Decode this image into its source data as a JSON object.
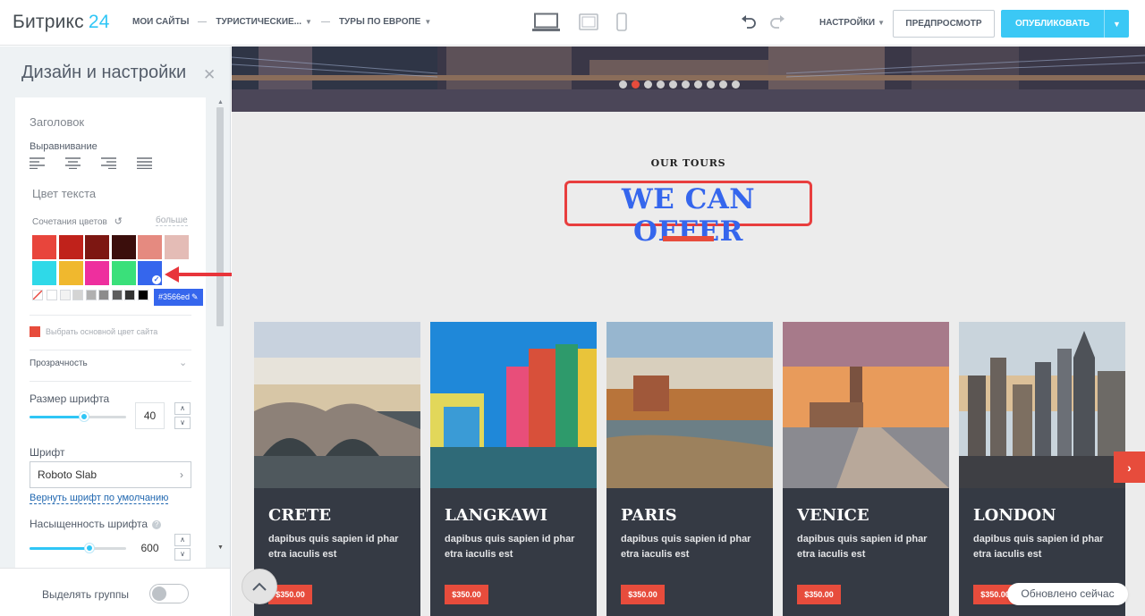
{
  "app": {
    "logo_name": "Битрикс",
    "logo_num": "24"
  },
  "breadcrumbs": [
    "МОИ САЙТЫ",
    "ТУРИСТИЧЕСКИЕ...",
    "ТУРЫ ПО ЕВРОПЕ"
  ],
  "toolbar": {
    "devices": [
      "desktop-icon",
      "tablet-icon",
      "mobile-icon"
    ],
    "active_device": "desktop-icon",
    "settings_label": "НАСТРОЙКИ",
    "preview_label": "ПРЕДПРОСМОТР",
    "publish_label": "ОПУБЛИКОВАТЬ"
  },
  "panel": {
    "title": "Дизайн и настройки",
    "section_title": "Заголовок",
    "alignment_label": "Выравнивание",
    "text_color_label": "Цвет текста",
    "color_combos_label": "Сочетания цветов",
    "more_label": "больше",
    "palette_row1": [
      "#e8453c",
      "#c0221b",
      "#7d1712",
      "#3b0e0c",
      "#e58a80",
      "#e4bcb6"
    ],
    "palette_row2": [
      "#2fd9e8",
      "#f0b82e",
      "#ee2f9e",
      "#3ae07a",
      "#3566ed"
    ],
    "selected_color": "#3566ed",
    "grays": [
      "#ffffff",
      "#f2f2f2",
      "#d4d4d4",
      "#b0b0b0",
      "#8c8c8c",
      "#5e5e5e",
      "#333333",
      "#000000"
    ],
    "hex_value": "#3566ed",
    "site_color_label": "Выбрать основной цвет сайта",
    "opacity_label": "Прозрачность",
    "font_size_label": "Размер шрифта",
    "font_size_value": "40",
    "font_size_fraction": 0.57,
    "font_label": "Шрифт",
    "font_value": "Roboto Slab",
    "reset_font_link": "Вернуть шрифт по умолчанию",
    "font_weight_label": "Насыщенность шрифта",
    "font_weight_value": "600",
    "font_weight_fraction": 0.63,
    "group_toggle_label": "Выделять группы",
    "group_toggle_on": false
  },
  "preview": {
    "slider_dot_count": 10,
    "slider_active_index": 1,
    "subtitle": "OUR TOURS",
    "heading": "WE CAN OFFER",
    "heading_color": "#3566ed",
    "tours": [
      {
        "name": "CRETE",
        "desc": "dapibus quis sapien id phar etra iaculis est",
        "price": "$350.00"
      },
      {
        "name": "LANGKAWI",
        "desc": "dapibus quis sapien id phar etra iaculis est",
        "price": "$350.00"
      },
      {
        "name": "PARIS",
        "desc": "dapibus quis sapien id phar etra iaculis est",
        "price": "$350.00"
      },
      {
        "name": "VENICE",
        "desc": "dapibus quis sapien id phar etra iaculis est",
        "price": "$350.00"
      },
      {
        "name": "LONDON",
        "desc": "dapibus quis sapien id phar etra iaculis est",
        "price": "$350.00"
      }
    ],
    "status_label": "Обновлено сейчас"
  }
}
